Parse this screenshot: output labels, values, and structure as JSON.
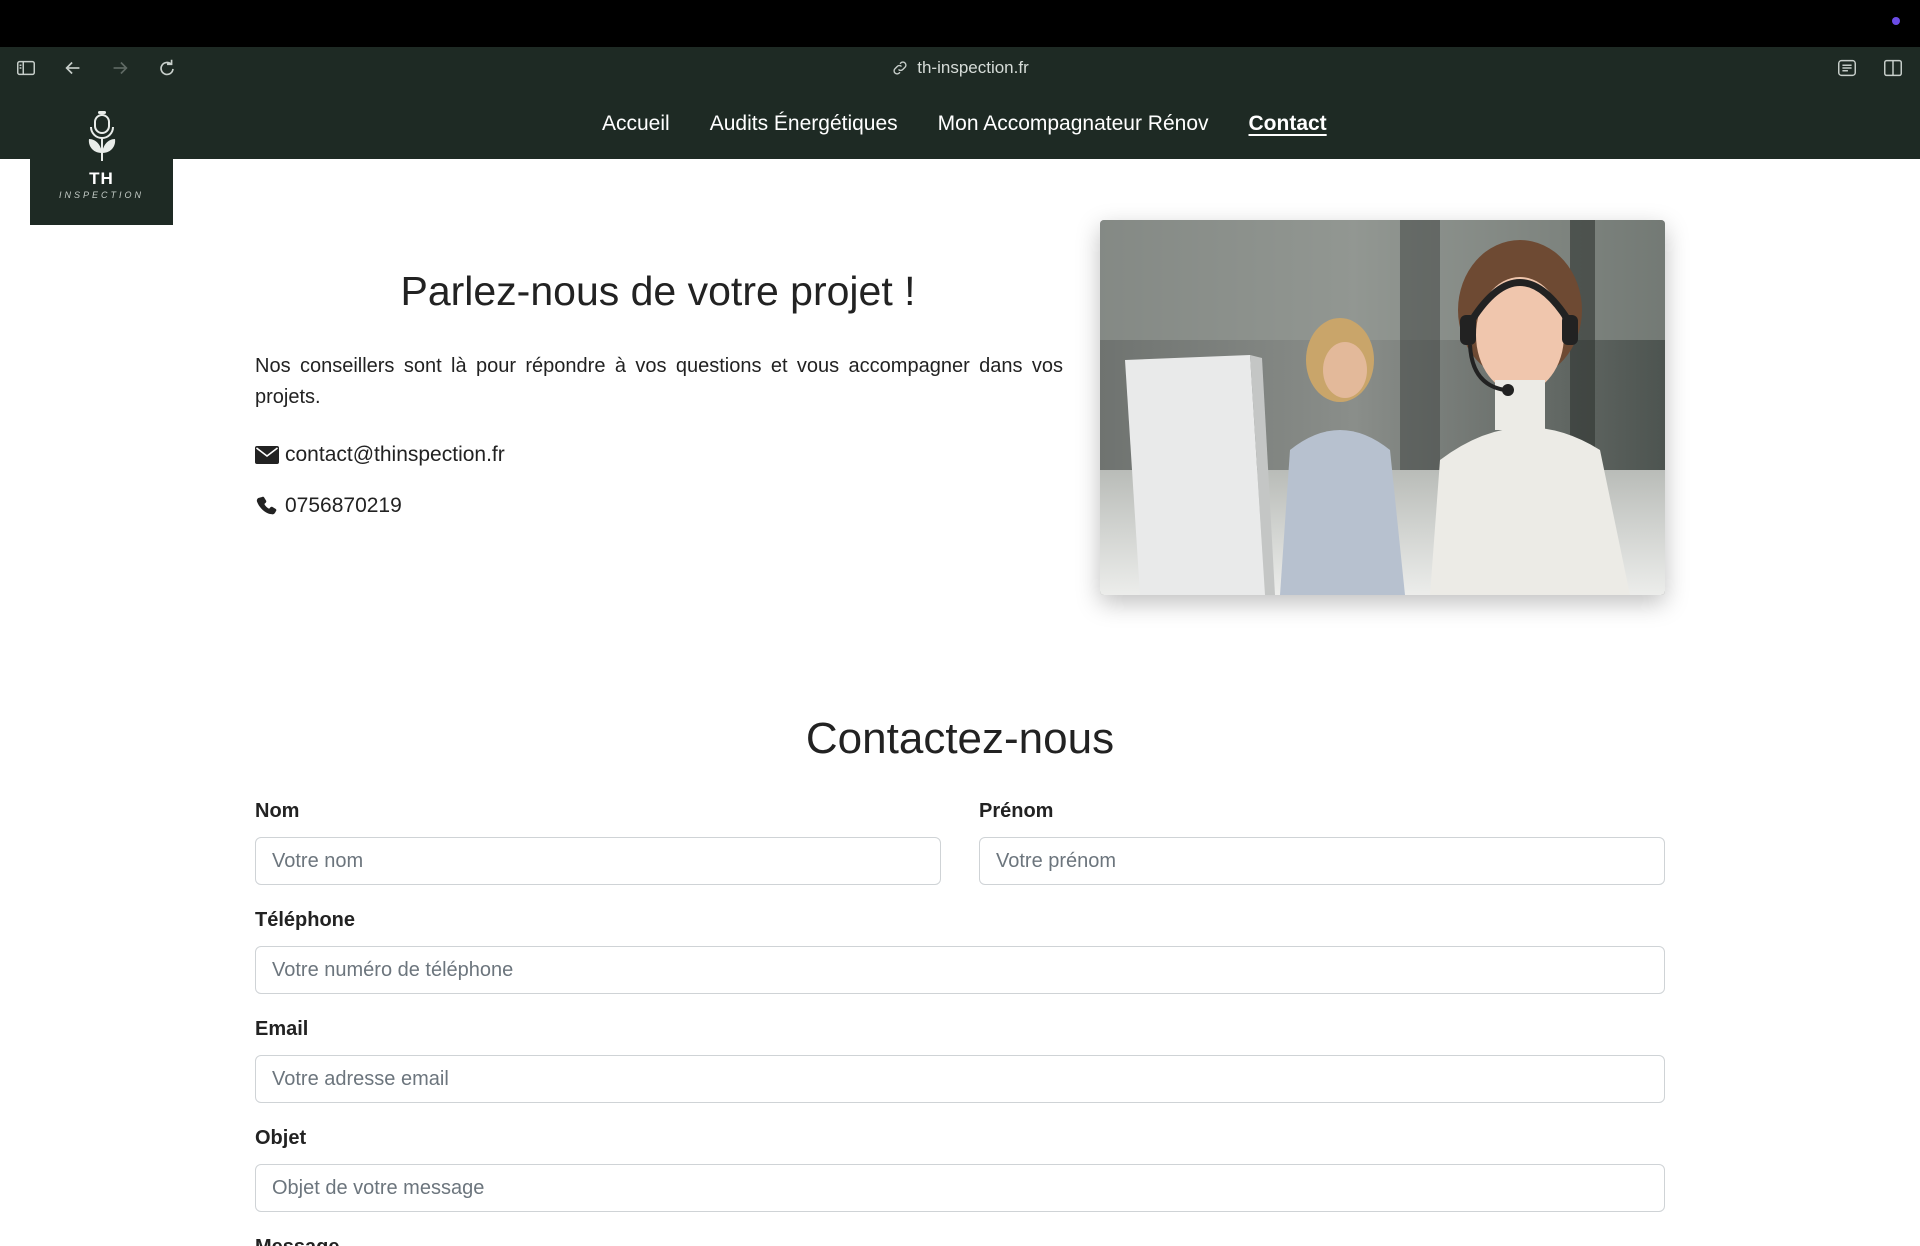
{
  "browser": {
    "url": "th-inspection.fr"
  },
  "logo": {
    "title": "TH",
    "subtitle": "INSPECTION"
  },
  "nav": {
    "items": [
      {
        "label": "Accueil",
        "active": false
      },
      {
        "label": "Audits Énergétiques",
        "active": false
      },
      {
        "label": "Mon Accompagnateur Rénov",
        "active": false
      },
      {
        "label": "Contact",
        "active": true
      }
    ]
  },
  "hero": {
    "title": "Parlez-nous de votre projet !",
    "text": "Nos conseillers sont là pour répondre à vos questions et vous accompagner dans vos projets.",
    "email": "contact@thinspection.fr",
    "phone": "0756870219"
  },
  "form": {
    "title": "Contactez-nous",
    "nom_label": "Nom",
    "nom_placeholder": "Votre nom",
    "prenom_label": "Prénom",
    "prenom_placeholder": "Votre prénom",
    "telephone_label": "Téléphone",
    "telephone_placeholder": "Votre numéro de téléphone",
    "email_label": "Email",
    "email_placeholder": "Votre adresse email",
    "objet_label": "Objet",
    "objet_placeholder": "Objet de votre message",
    "message_label": "Message"
  },
  "colors": {
    "header_bg": "#1e2a24",
    "accent_dot": "#6b4ce6"
  },
  "icons": [
    "sidebar-icon",
    "back-icon",
    "forward-icon",
    "reload-icon",
    "link-icon",
    "reader-icon",
    "split-view-icon",
    "envelope-icon",
    "phone-icon"
  ]
}
